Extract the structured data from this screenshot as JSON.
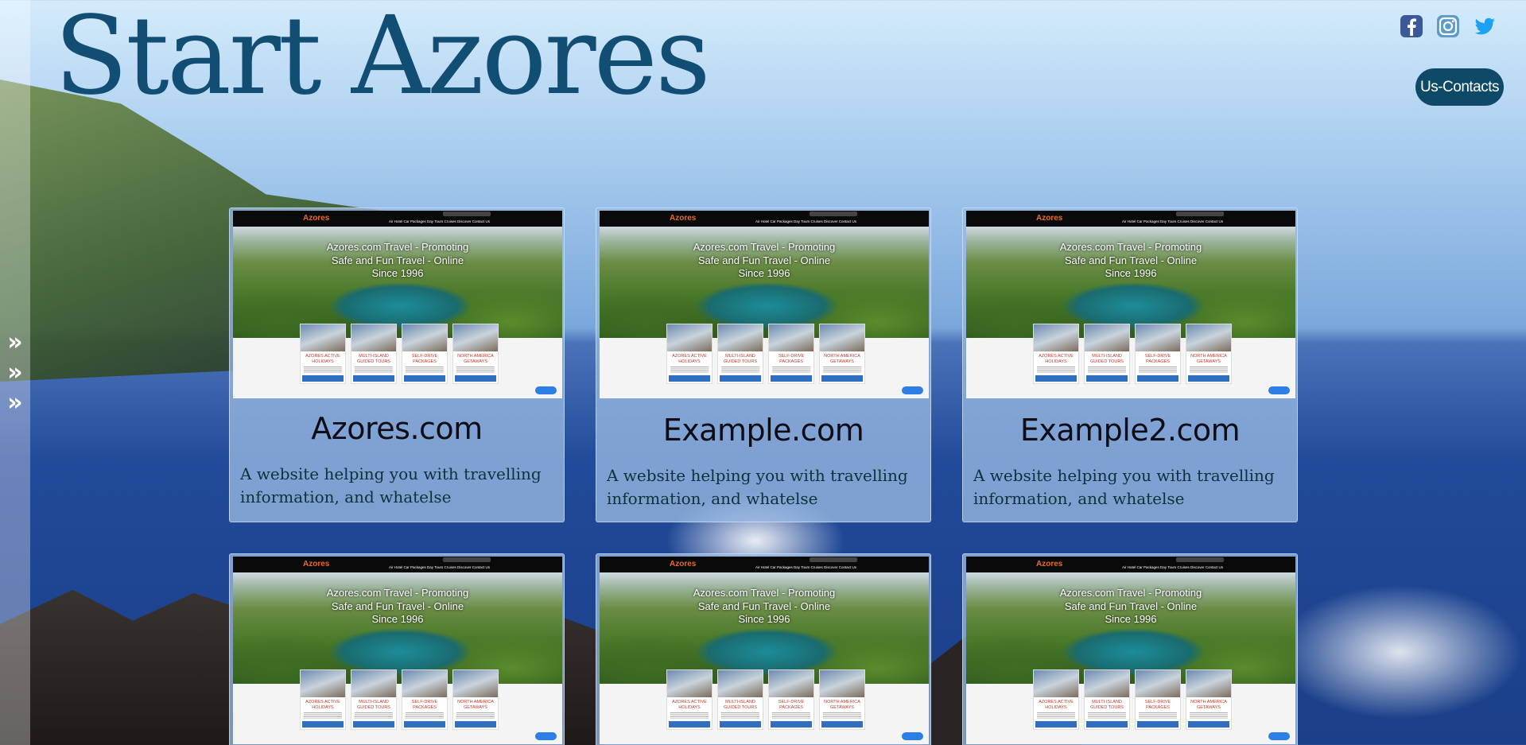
{
  "header": {
    "title": "Start Azores",
    "contact_label": "Us-Contacts"
  },
  "socials": [
    {
      "icon": "facebook-icon",
      "color": "#3b5998"
    },
    {
      "icon": "instagram-icon",
      "color": "#4f8fbf"
    },
    {
      "icon": "twitter-icon",
      "color": "#1da1f2"
    }
  ],
  "sidebar": {
    "arrows": [
      "»",
      "»",
      "»"
    ]
  },
  "screenshot": {
    "logo": "Azores",
    "nav": "Air  Hotel  Car  Packages  Day Tours  Cruises  Discover  Contact Us",
    "headline": [
      "Azores.com Travel - Promoting",
      "Safe and Fun Travel - Online",
      "Since 1996"
    ],
    "packages": [
      {
        "title": [
          "AZORES ACTIVE",
          "HOLIDAYS"
        ]
      },
      {
        "title": [
          "MULTI-ISLAND",
          "GUIDED TOURS"
        ]
      },
      {
        "title": [
          "SELF-DRIVE",
          "PACKAGES"
        ]
      },
      {
        "title": [
          "NORTH AMERICA",
          "GETAWAYS"
        ]
      }
    ]
  },
  "cards": [
    {
      "title": "Azores.com",
      "description": "A website helping you with travelling information, and whatelse"
    },
    {
      "title": "Example.com",
      "description": "A website helping you with travelling information, and whatelse"
    },
    {
      "title": "Example2.com",
      "description": "A website helping you with travelling information, and whatelse"
    },
    {
      "title": "",
      "description": ""
    },
    {
      "title": "",
      "description": ""
    },
    {
      "title": "",
      "description": ""
    }
  ],
  "colors": {
    "title": "#124e74",
    "contact_button": "#0e4a68",
    "card_bg": "#98b9e1"
  }
}
